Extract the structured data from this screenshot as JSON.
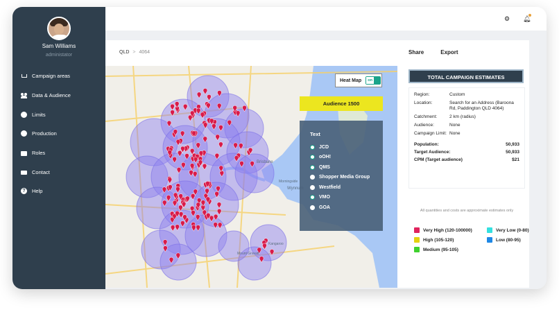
{
  "user": {
    "name": "Sam Williams",
    "role": "administator"
  },
  "sidebar": {
    "items": [
      {
        "label": "Campaign areas",
        "icon": "cart-icon"
      },
      {
        "label": "Data & Audience",
        "icon": "people-icon"
      },
      {
        "label": "Limits",
        "icon": "circle-icon"
      },
      {
        "label": "Production",
        "icon": "circle-icon"
      },
      {
        "label": "Roles",
        "icon": "id-card-icon"
      },
      {
        "label": "Contact",
        "icon": "mail-icon"
      },
      {
        "label": "Help",
        "icon": "help-icon"
      }
    ]
  },
  "topbar": {
    "settings_icon": "gear-icon",
    "notifications_icon": "bell-icon"
  },
  "breadcrumb": {
    "state": "QLD",
    "postcode": "4064"
  },
  "actions": {
    "share": "Share",
    "export": "Export"
  },
  "map": {
    "heatmap": {
      "label": "Heat Map",
      "toggle_state": "on"
    },
    "audience_button": "Audience 1500",
    "place_labels": [
      "Brisbane",
      "Wynnum",
      "Morningside",
      "Kangaroo",
      "Mount Gravatt"
    ],
    "legend": {
      "title": "Text",
      "items": [
        {
          "label": "JCD",
          "selected": true
        },
        {
          "label": "oOH!",
          "selected": true
        },
        {
          "label": "QMS",
          "selected": true
        },
        {
          "label": "Shopper Media Group",
          "selected": false
        },
        {
          "label": "Westfield",
          "selected": false
        },
        {
          "label": "VMO",
          "selected": true
        },
        {
          "label": "GOA",
          "selected": false
        }
      ]
    }
  },
  "estimates": {
    "title": "TOTAL CAMPAIGN ESTIMATES",
    "rows": [
      {
        "key": "Region:",
        "value": "Custom"
      },
      {
        "key": "Location:",
        "value": "Search for an Address (Baroona Rd, Paddington QLD 4064)"
      },
      {
        "key": "Catchment:",
        "value": "2 km (radius)"
      },
      {
        "key": "Audience:",
        "value": "None"
      },
      {
        "key": "Campaign Limit:",
        "value": "None"
      }
    ],
    "stats": [
      {
        "label": "Population:",
        "value": "50,933"
      },
      {
        "label": "Target Audience:",
        "value": "50,933"
      },
      {
        "label": "CPM (Target audience)",
        "value": "$21"
      }
    ],
    "note": "All quantities and costs are approximate estimates only"
  },
  "scale": [
    {
      "label": "Very High (120-100000)",
      "color": "#e0245e"
    },
    {
      "label": "Very Low (0-80)",
      "color": "#34e0e0"
    },
    {
      "label": "High (105-120)",
      "color": "#e4d10f"
    },
    {
      "label": "Low (80-95)",
      "color": "#1e88e5"
    },
    {
      "label": "Medium (95-105)",
      "color": "#3fd12e"
    }
  ],
  "colors": {
    "sidebar": "#2f3f4d",
    "pin": "#d81b4a",
    "circle": "#8b7ef0",
    "water": "#a9c8f5",
    "toggle": "#1aa38a",
    "audience": "#ece61f"
  }
}
